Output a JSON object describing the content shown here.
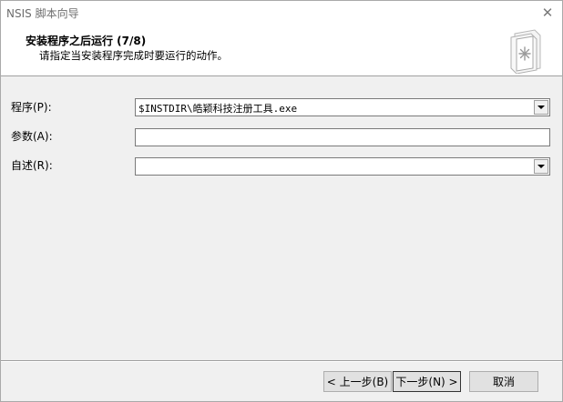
{
  "window": {
    "title": "NSIS 脚本向导",
    "close_symbol": "✕"
  },
  "header": {
    "title": "安装程序之后运行 (7/8)",
    "subtitle": "请指定当安装程序完成时要运行的动作。",
    "icon": "document-stack-icon"
  },
  "form": {
    "program": {
      "label": "程序(P):",
      "value": "$INSTDIR\\皓颖科技注册工具.exe"
    },
    "params": {
      "label": "参数(A):",
      "value": ""
    },
    "description": {
      "label": "自述(R):",
      "value": ""
    }
  },
  "buttons": {
    "back": "< 上一步(B)",
    "next": "下一步(N) >",
    "cancel": "取消"
  },
  "colors": {
    "header_bg": "#ffffff",
    "body_bg": "#f0f0f0",
    "border": "#7a7a7a"
  }
}
